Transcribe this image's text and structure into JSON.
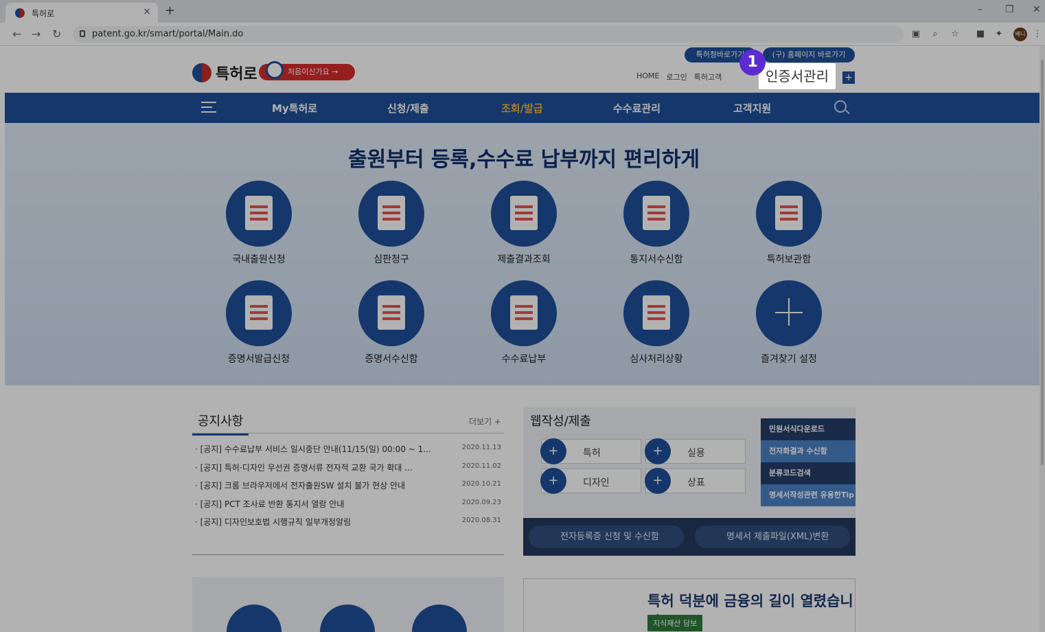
{
  "browser": {
    "tab_title": "특허로",
    "url": "patent.go.kr/smart/portal/Main.do",
    "profile_initials": "베니"
  },
  "header": {
    "logo_text": "특허로",
    "newbie_label": "처음이신가요 →",
    "pill_kipo": "특허청바로가기",
    "pill_old": "(구) 홈페이지 바로가기",
    "util": [
      "HOME",
      "로그인",
      "특허고객"
    ],
    "plus": "+"
  },
  "gnb": {
    "items": [
      "My특허로",
      "신청/제출",
      "조회/발급",
      "수수료관리",
      "고객지원"
    ],
    "active_index": 2
  },
  "hero": {
    "headline": "출원부터 등록,수수료 납부까지 편리하게",
    "services": [
      "국내출원신청",
      "심판청구",
      "제출결과조회",
      "통지서수신함",
      "특허보관함",
      "증명서발급신청",
      "증명서수신함",
      "수수료납부",
      "심사처리상황",
      "즐겨찾기 설정"
    ]
  },
  "notice": {
    "title": "공지사항",
    "more": "더보기 +",
    "items": [
      {
        "text": "· [공지] 수수료납부 서비스 일시중단 안내(11/15(일) 00:00 ~ 1...",
        "date": "2020.11.13"
      },
      {
        "text": "· [공지] 특허·디자인 우선권 증명서류 전자적 교환 국가 확대 ...",
        "date": "2020.11.02"
      },
      {
        "text": "· [공지] 크롬 브라우저에서 전자출원SW 설치 불가 현상 안내",
        "date": "2020.10.21"
      },
      {
        "text": "· [공지] PCT 조사료 반환 통지서 열람 안내",
        "date": "2020.09.23"
      },
      {
        "text": "· [공지] 디자인보호법 시행규칙 일부개정알림",
        "date": "2020.08.31"
      }
    ]
  },
  "web": {
    "title": "웹작성/제출",
    "buttons": [
      "특허",
      "실용",
      "디자인",
      "상표"
    ],
    "side": [
      "민원서식다운로드",
      "전자화결과 수신함",
      "분류코드검색",
      "명세서작성관련 유용한Tip"
    ],
    "strip": [
      "전자등록증 신청 및 수신함",
      "명세서 제출파일(XML)변환"
    ]
  },
  "banner": {
    "title": "특허 덕분에 금융의 길이 열렸습니다.",
    "sub": "지식재산 담보"
  },
  "overlay": {
    "step": "1",
    "tooltip": "인증서관리"
  }
}
